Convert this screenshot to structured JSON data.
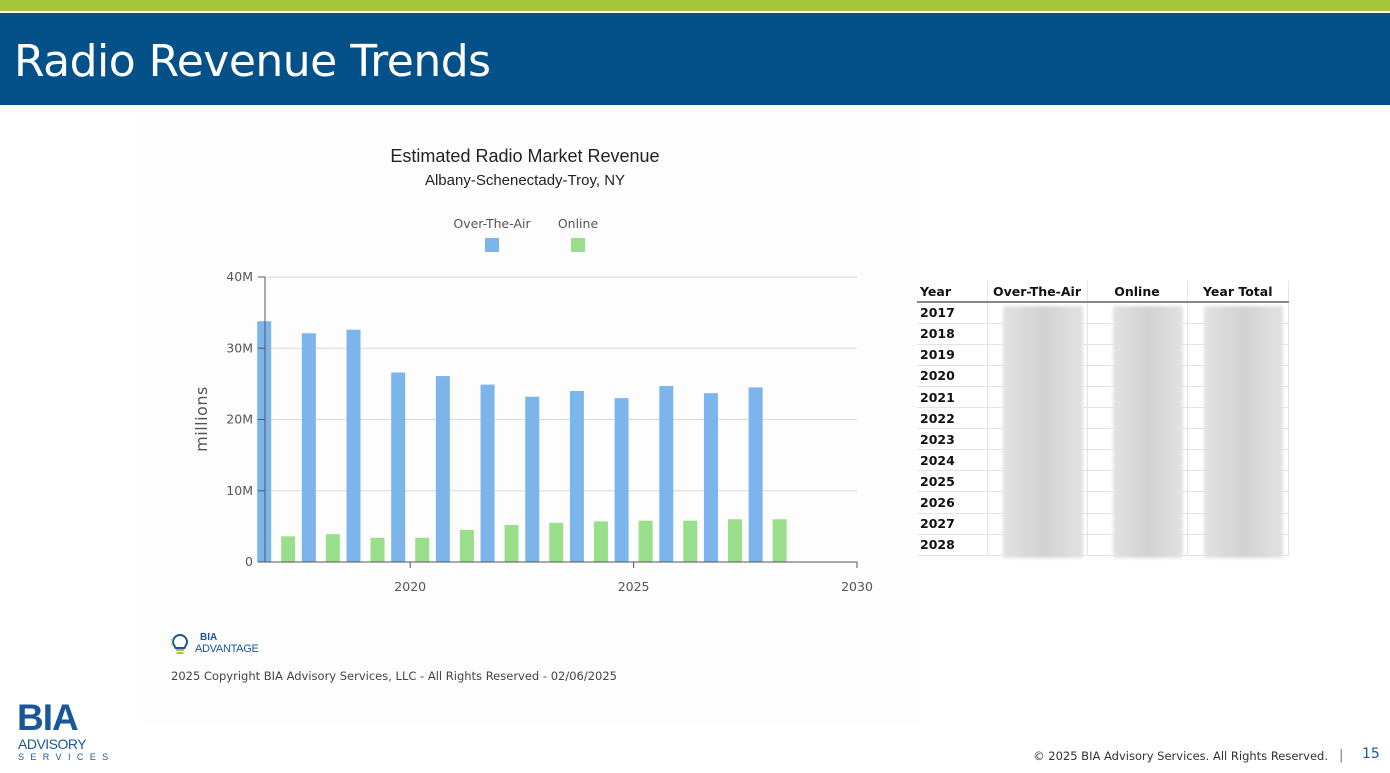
{
  "slide": {
    "title": "Radio Revenue Trends",
    "footer_copyright": "© 2025 BIA Advisory Services. All Rights Reserved.",
    "footer_separator": "|",
    "page_number": "15",
    "logo": {
      "line1": "BIA",
      "line2": "ADVISORY",
      "line3": "SERVICES"
    },
    "colors": {
      "title_bar": "#045189",
      "accent_stripe": "#a5c63b",
      "brand_blue": "#1a5799"
    }
  },
  "chart_data": {
    "type": "bar",
    "title": "Estimated Radio Market Revenue",
    "subtitle": "Albany-Schenectady-Troy, NY",
    "ylabel": "millions",
    "xlabel": "",
    "ylim": [
      0,
      40000000
    ],
    "xlim": [
      2016.75,
      2030
    ],
    "y_ticks": [
      0,
      10000000,
      20000000,
      30000000,
      40000000
    ],
    "y_tick_labels": [
      "0",
      "10M",
      "20M",
      "30M",
      "40M"
    ],
    "x_ticks": [
      2020,
      2025,
      2030
    ],
    "x_tick_labels": [
      "2020",
      "2025",
      "2030"
    ],
    "grid": true,
    "legend_position": "top-center",
    "x": [
      2017,
      2018,
      2019,
      2020,
      2021,
      2022,
      2023,
      2024,
      2025,
      2026,
      2027,
      2028
    ],
    "series": [
      {
        "name": "Over-The-Air",
        "color": "#7cb5ec",
        "values": [
          33800000,
          32100000,
          32600000,
          26600000,
          26100000,
          24900000,
          23200000,
          24000000,
          23000000,
          24700000,
          23700000,
          24500000
        ]
      },
      {
        "name": "Online",
        "color": "#98de8b",
        "values": [
          3600000,
          3900000,
          3400000,
          3400000,
          4500000,
          5200000,
          5500000,
          5700000,
          5800000,
          5800000,
          6000000,
          6000000
        ]
      }
    ],
    "footer_note": "2025 Copyright BIA Advisory Services, LLC - All Rights Reserved - 02/06/2025",
    "brand_mark": "BIA ADVANTAGE"
  },
  "table": {
    "headers": [
      "Year",
      "Over-The-Air",
      "Online",
      "Year Total"
    ],
    "years": [
      "2017",
      "2018",
      "2019",
      "2020",
      "2021",
      "2022",
      "2023",
      "2024",
      "2025",
      "2026",
      "2027",
      "2028"
    ]
  }
}
